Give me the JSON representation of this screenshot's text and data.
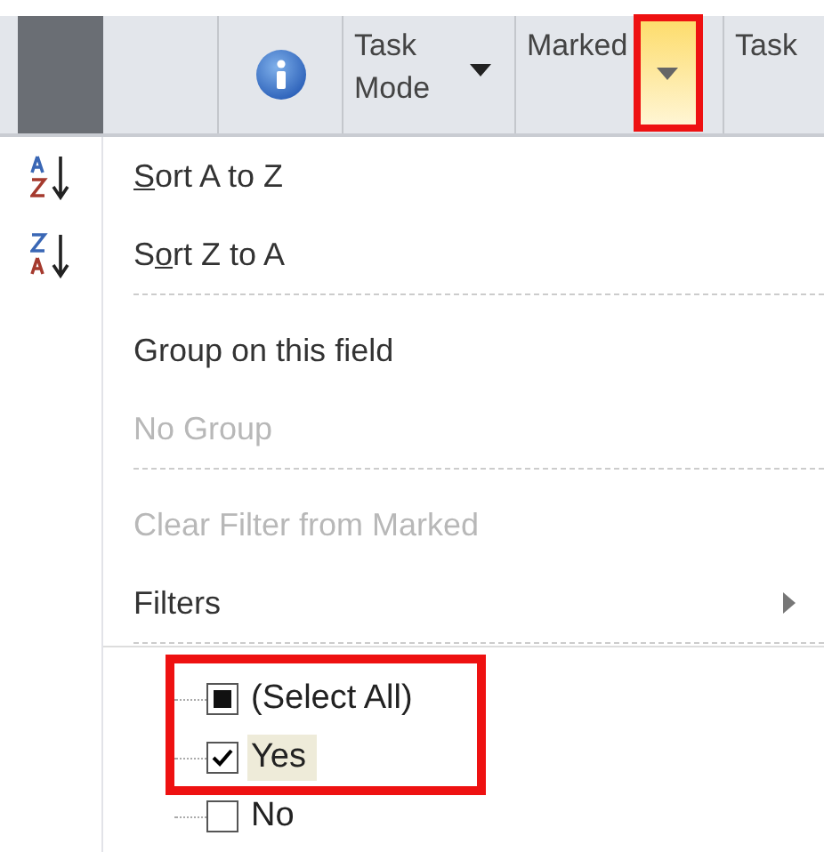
{
  "header": {
    "columns": [
      {
        "kind": "indicator"
      },
      {
        "kind": "blank"
      },
      {
        "kind": "info"
      },
      {
        "kind": "field",
        "label": "Task Mode",
        "dropdown": true
      },
      {
        "kind": "field",
        "label": "Marked",
        "dropdown": true,
        "active": true,
        "annotated": true
      },
      {
        "kind": "field",
        "label": "Task"
      }
    ]
  },
  "menu": {
    "items": [
      {
        "kind": "sort_ascending",
        "label": "Sort A to Z",
        "disabled": false
      },
      {
        "kind": "sort_descending",
        "label": "Sort Z to A",
        "disabled": false
      },
      {
        "kind": "separator"
      },
      {
        "kind": "item",
        "label": "Group on this field",
        "disabled": false
      },
      {
        "kind": "item",
        "label": "No Group",
        "disabled": true
      },
      {
        "kind": "separator"
      },
      {
        "kind": "item",
        "label": "Clear Filter from Marked",
        "disabled": true
      },
      {
        "kind": "item",
        "label": "Filters",
        "submenu": true,
        "disabled": false
      },
      {
        "kind": "separator"
      }
    ],
    "filter_list": [
      {
        "label": "(Select All)",
        "checked": false,
        "partial": true,
        "selected": false,
        "annotated": true
      },
      {
        "label": "Yes",
        "checked": true,
        "partial": false,
        "selected": true,
        "annotated": true
      },
      {
        "label": "No",
        "checked": false,
        "partial": false,
        "selected": false,
        "annotated": false
      }
    ]
  }
}
